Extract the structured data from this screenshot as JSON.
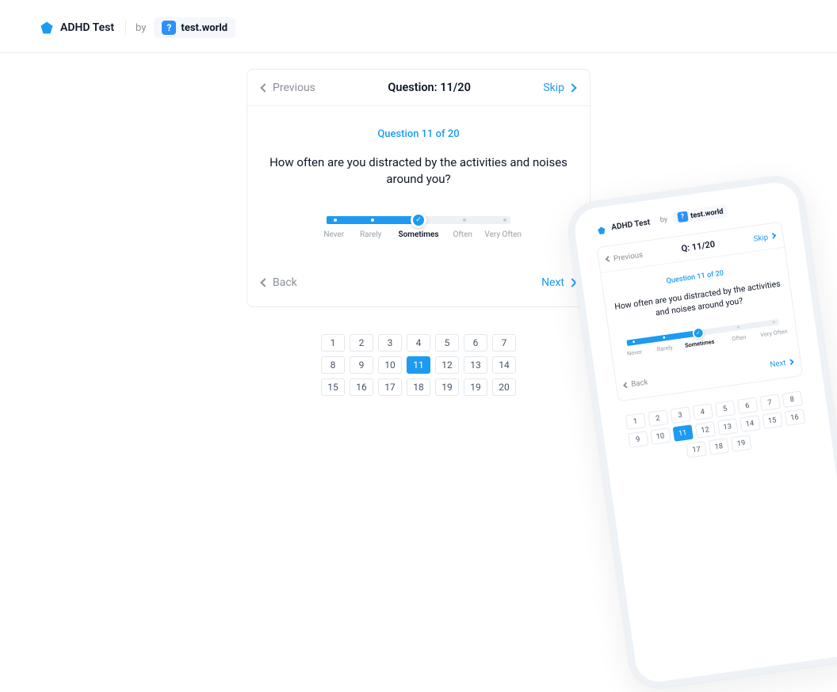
{
  "header": {
    "app_name": "ADHD Test",
    "by": "by",
    "chip_glyph": "?",
    "chip_label": "test.world"
  },
  "card": {
    "prev": "Previous",
    "skip": "Skip",
    "back": "Back",
    "next": "Next",
    "title": "Question: 11/20",
    "subtitle": "Question 11 of 20",
    "question": "How often are you distracted by the activities and noises around you?"
  },
  "slider": {
    "options": [
      "Never",
      "Rarely",
      "Sometimes",
      "Often",
      "Very Often"
    ],
    "selected_index": 2,
    "handle_glyph": "✓"
  },
  "pager": {
    "pages": [
      1,
      2,
      3,
      4,
      5,
      6,
      7,
      8,
      9,
      10,
      11,
      12,
      13,
      14,
      15,
      16,
      17,
      18,
      19,
      19,
      20
    ],
    "active": 11
  },
  "phone": {
    "card": {
      "prev": "Previous",
      "skip": "Skip",
      "back": "Back",
      "next": "Next",
      "title": "Q: 11/20",
      "subtitle": "Question 11 of 20",
      "question": "How often are you distracted by the activities and noises around you?"
    },
    "pager": {
      "pages": [
        1,
        2,
        3,
        4,
        5,
        6,
        7,
        8,
        9,
        10,
        11,
        12,
        13,
        14,
        15,
        16,
        17,
        18,
        19
      ],
      "active": 11
    }
  },
  "colors": {
    "accent": "#1d9bf0"
  }
}
